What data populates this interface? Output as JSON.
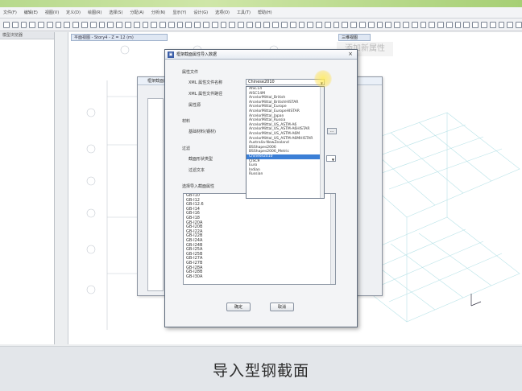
{
  "menubar": {
    "items": [
      "文件(F)",
      "编辑(E)",
      "视图(V)",
      "定义(D)",
      "绘图(R)",
      "选择(S)",
      "分配(A)",
      "分析(N)",
      "显示(Y)",
      "设计(G)",
      "选项(O)",
      "工具(T)",
      "帮助(H)"
    ]
  },
  "left_pane": {
    "title": "模型浏览器"
  },
  "canvas": {
    "tab_label": "平面视图 - Story4 - Z = 12 (m)",
    "tab3d_label": "三维视图"
  },
  "tip_label": "添加新属性",
  "back_dialog": {
    "title": "框架截面属性"
  },
  "dialog": {
    "title": "框架截面属性导入数据",
    "section_property_file": "属性文件",
    "xml_file_label": "XML 属性文件名称",
    "xml_file_value": "Chinese2010",
    "xml_file_label2": "XML 属性文件路径",
    "source_label": "属性源",
    "mode_label": "材料",
    "base_material_label": "基础材料(钢材)",
    "filter_label": "过滤",
    "section_type_label": "截面形状类型",
    "filter_text_label": "过滤文本",
    "select_label": "选择导入截面属性",
    "ok_label": "确定",
    "cancel_label": "取消",
    "list_items": [
      "GB-I10",
      "GB-I12",
      "GB-I12.6",
      "GB-I14",
      "GB-I16",
      "GB-I18",
      "GB-I20A",
      "GB-I20B",
      "GB-I22A",
      "GB-I22B",
      "GB-I24A",
      "GB-I24B",
      "GB-I25A",
      "GB-I25B",
      "GB-I27A",
      "GB-I27B",
      "GB-I28A",
      "GB-I28B",
      "GB-I30A"
    ]
  },
  "dropdown": {
    "options": [
      "AISC14",
      "AISC14M",
      "ArcelorMittal_British",
      "ArcelorMittal_BritishHISTAR",
      "ArcelorMittal_Europe",
      "ArcelorMittal_EuropeHISTAR",
      "ArcelorMittal_Japan",
      "ArcelorMittal_Russia",
      "ArcelorMittal_US_ASTM-A6",
      "ArcelorMittal_US_ASTM-A6HISTAR",
      "ArcelorMittal_US_ASTM-A6M",
      "ArcelorMittal_US_ASTM-A6MHISTAR",
      "Australia-NewZealand",
      "BSShapes2006",
      "BSShapes2006_Metric",
      "Chinese2010",
      "CISC9",
      "Euro",
      "Indian",
      "Russian"
    ],
    "selected": "Chinese2010"
  },
  "subtitle": "导入型钢截面"
}
